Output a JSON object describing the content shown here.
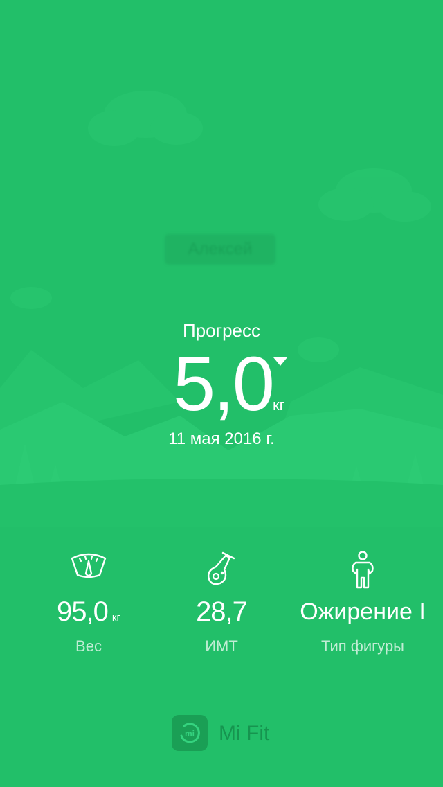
{
  "profile": {
    "username": "Алексей"
  },
  "progress": {
    "label": "Прогресс",
    "value": "5,0",
    "unit": "кг",
    "direction_icon": "triangle-down-icon",
    "date": "11 мая 2016 г."
  },
  "stats": [
    {
      "icon": "scale-icon",
      "value": "95,0",
      "unit": "кг",
      "label": "Вес"
    },
    {
      "icon": "flask-icon",
      "value": "28,7",
      "unit": "",
      "label": "ИМТ"
    },
    {
      "icon": "person-icon",
      "value": "Ожирение I",
      "unit": "",
      "label": "Тип фигуры"
    }
  ],
  "footer": {
    "logo_icon": "mi-logo-icon",
    "app_name": "Mi Fit"
  },
  "colors": {
    "background": "#22bf69",
    "scenery": "#27c770",
    "text": "#ffffff"
  }
}
